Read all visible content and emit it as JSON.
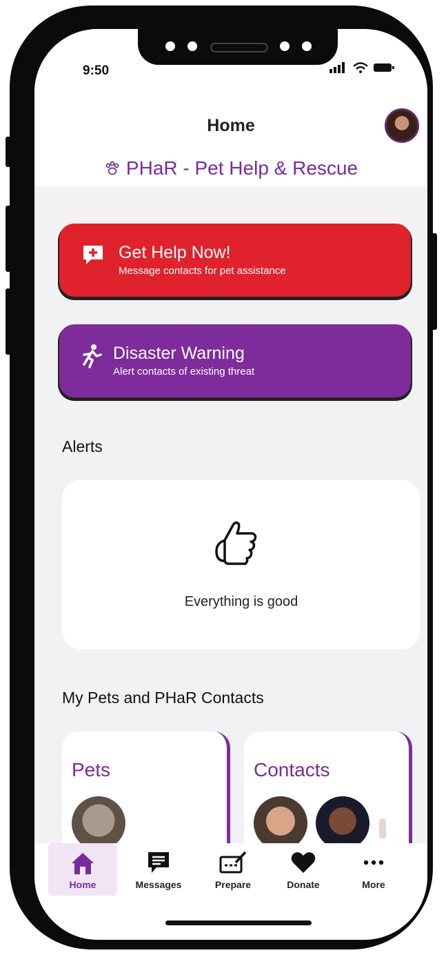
{
  "status_bar": {
    "time": "9:50"
  },
  "header": {
    "title": "Home",
    "app_name": "PHaR - Pet Help & Rescue"
  },
  "actions": {
    "help": {
      "title": "Get Help Now!",
      "subtitle": "Message contacts for pet assistance",
      "color": "#e0222c"
    },
    "disaster": {
      "title": "Disaster Warning",
      "subtitle": "Alert contacts of existing threat",
      "color": "#7e2c9b"
    }
  },
  "alerts": {
    "heading": "Alerts",
    "message": "Everything is good",
    "icon": "thumbs-up-icon"
  },
  "pets_contacts": {
    "heading": "My Pets and PHaR Contacts",
    "pets_label": "Pets",
    "contacts_label": "Contacts"
  },
  "tabbar": {
    "items": [
      {
        "label": "Home",
        "icon": "home-icon",
        "active": true
      },
      {
        "label": "Messages",
        "icon": "message-icon",
        "active": false
      },
      {
        "label": "Prepare",
        "icon": "checklist-icon",
        "active": false
      },
      {
        "label": "Donate",
        "icon": "heart-icon",
        "active": false
      },
      {
        "label": "More",
        "icon": "more-icon",
        "active": false
      }
    ]
  },
  "colors": {
    "accent": "#7a2b9a",
    "danger": "#e0222c"
  }
}
